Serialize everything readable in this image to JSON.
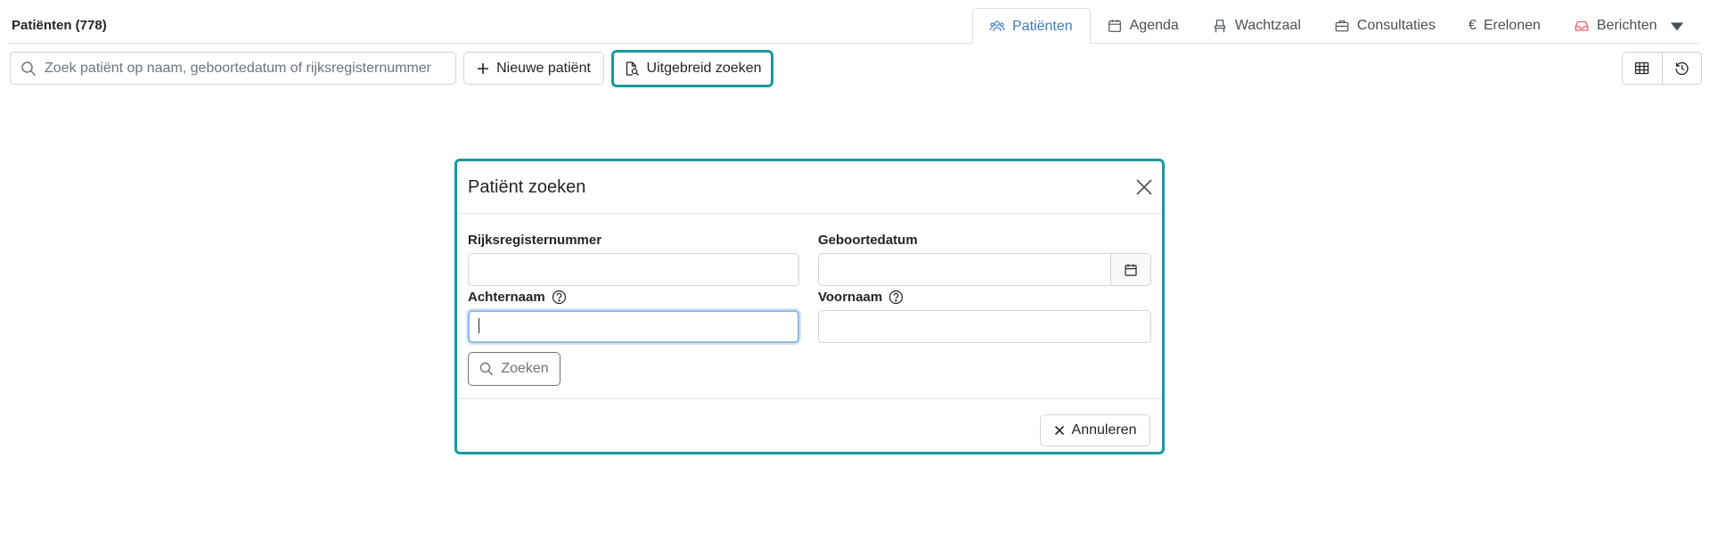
{
  "header": {
    "title": "Patiënten (778)",
    "tabs": [
      {
        "label": "Patiënten",
        "icon": "people-icon",
        "active": true
      },
      {
        "label": "Agenda",
        "icon": "calendar-icon",
        "active": false
      },
      {
        "label": "Wachtzaal",
        "icon": "chair-icon",
        "active": false
      },
      {
        "label": "Consultaties",
        "icon": "briefcase-icon",
        "active": false
      },
      {
        "label": "Erelonen",
        "icon": "euro-icon",
        "active": false
      },
      {
        "label": "Berichten",
        "icon": "inbox-icon",
        "active": false
      }
    ]
  },
  "toolbar": {
    "search_placeholder": "Zoek patiënt op naam, geboortedatum of rijksregisternummer",
    "search_value": "",
    "new_patient_label": "Nieuwe patiënt",
    "advanced_search_label": "Uitgebreid zoeken"
  },
  "modal": {
    "title": "Patiënt zoeken",
    "rijksregister_label": "Rijksregisternummer",
    "rijksregister_value": "",
    "geboortedatum_label": "Geboortedatum",
    "geboortedatum_value": "",
    "achternaam_label": "Achternaam",
    "achternaam_value": "",
    "voornaam_label": "Voornaam",
    "voornaam_value": "",
    "search_button_label": "Zoeken",
    "cancel_button_label": "Annuleren"
  },
  "colors": {
    "accent_teal": "#1a9a9e",
    "active_tab": "#3b7bbf",
    "inbox_red": "#e35d5d"
  }
}
